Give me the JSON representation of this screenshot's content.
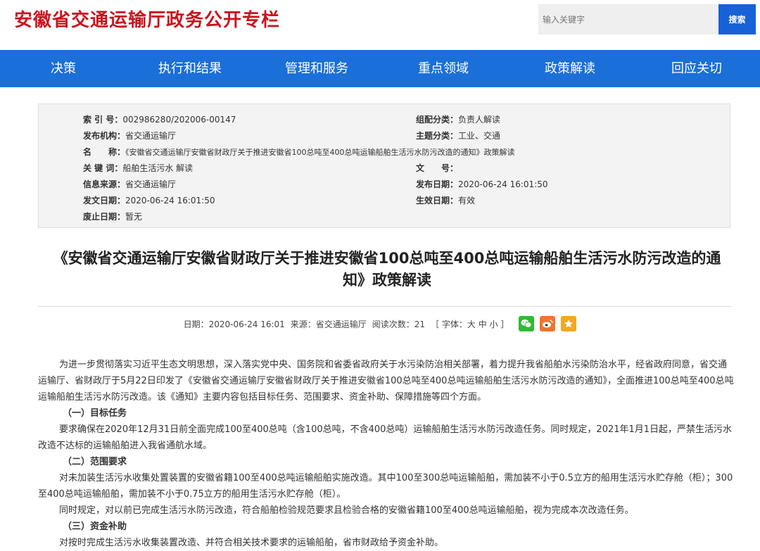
{
  "header": {
    "site_title": "安徽省交通运输厅政务公开专栏",
    "search_placeholder": "输入关键字",
    "search_button": "搜索"
  },
  "nav": {
    "items": [
      "决策",
      "执行和结果",
      "管理和服务",
      "重点领域",
      "政策解读",
      "回应关切"
    ]
  },
  "meta": {
    "index_label": "索 引 号：",
    "index_value": "002986280/202006-00147",
    "category_label": "组配分类：",
    "category_value": "负责人解读",
    "publisher_label": "发布机构：",
    "publisher_value": "省交通运输厅",
    "topic_label": "主题分类：",
    "topic_value": "工业、交通",
    "name_label": "名　　称：",
    "name_value": "《安徽省交通运输厅安徽省财政厅关于推进安徽省100总吨至400总吨运输船舶生活污水防污改造的通知》政策解读",
    "keywords_label": "关 键 词：",
    "keywords_value": "船舶生活污水 解读",
    "docno_label": "文　　号：",
    "docno_value": "",
    "source_label": "信息来源：",
    "source_value": "省交通运输厅",
    "pubdate_label": "发布日期：",
    "pubdate_value": "2020-06-24 16:01:50",
    "issuedate_label": "发文日期：",
    "issuedate_value": "2020-06-24 16:01:50",
    "effective_label": "生效日期：",
    "effective_value": "有效",
    "abolish_label": "废止日期：",
    "abolish_value": "暂无"
  },
  "article": {
    "title": "《安徽省交通运输厅安徽省财政厅关于推进安徽省100总吨至400总吨运输船舶生活污水防污改造的通知》政策解读",
    "date": "日期：2020-06-24 16:01",
    "source": "来源：省交通运输厅",
    "views": "阅读次数：21",
    "font_size": "［ 字体：大 中 小 ］",
    "para1": "为进一步贯彻落实习近平生态文明思想，深入落实党中央、国务院和省委省政府关于水污染防治相关部署，着力提升我省船舶水污染防治水平，经省政府同意，省交通运输厅、省财政厅于5月22日印发了《安徽省交通运输厅安徽省财政厅关于推进安徽省100总吨至400总吨运输船舶生活污水防污改造的通知》，全面推进100总吨至400总吨运输船舶生活污水防污改造。该《通知》主要内容包括目标任务、范围要求、资金补助、保障措施等四个方面。",
    "h1": "（一）目标任务",
    "para2": "要求确保在2020年12月31日前全面完成100至400总吨（含100总吨，不含400总吨）运输船舶生活污水防污改造任务。同时规定，2021年1月1日起，严禁生活污水改造不达标的运输船舶进入我省通航水域。",
    "h2": "（二）范围要求",
    "para3": "对未加装生活污水收集处置装置的安徽省籍100至400总吨运输船舶实施改造。其中100至300总吨运输船舶，需加装不小于0.5立方的船用生活污水贮存舱（柜）；300至400总吨运输船舶，需加装不小于0.75立方的船用生活污水贮存舱（柜）。",
    "para4": "同时规定，对以前已完成生活污水防污改造，符合船舶检验规范要求且检验合格的安徽省籍100至400总吨运输船舶，视为完成本次改造任务。",
    "h3": "（三）资金补助",
    "para5": "对按时完成生活污水收集装置改造、并符合相关技术要求的运输船舶，省市财政给予资金补助。"
  }
}
